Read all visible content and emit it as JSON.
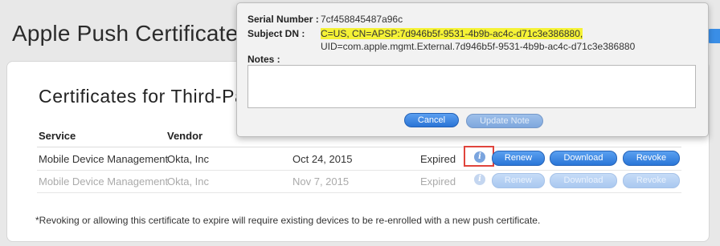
{
  "page": {
    "title": "Apple Push Certificates",
    "section_title": "Certificates for Third-Pa"
  },
  "table": {
    "headers": {
      "service": "Service",
      "vendor": "Vendor"
    },
    "rows": [
      {
        "service": "Mobile Device Management",
        "vendor": "Okta, Inc",
        "date": "Oct 24, 2015",
        "status": "Expired",
        "actions": {
          "renew": "Renew",
          "download": "Download",
          "revoke": "Revoke"
        }
      },
      {
        "service": "Mobile Device Management",
        "vendor": "Okta, Inc",
        "date": "Nov 7, 2015",
        "status": "Expired",
        "actions": {
          "renew": "Renew",
          "download": "Download",
          "revoke": "Revoke"
        }
      }
    ]
  },
  "footnote": "*Revoking or allowing this certificate to expire will require existing devices to be re-enrolled with a new push certificate.",
  "popover": {
    "serial_label": "Serial Number :",
    "serial_value": "7cf458845487a96c",
    "subject_label": "Subject DN :",
    "subject_line1": "C=US, CN=APSP:7d946b5f-9531-4b9b-ac4c-d71c3e386880,",
    "subject_line2": "UID=com.apple.mgmt.External.7d946b5f-9531-4b9b-ac4c-d71c3e386880",
    "notes_label": "Notes :",
    "notes_value": "",
    "cancel_label": "Cancel",
    "update_label": "Update Note"
  },
  "icons": {
    "info": "info-icon"
  },
  "colors": {
    "accent": "#2a76d8",
    "highlight": "#f5f236",
    "annotation": "#e0443c"
  }
}
